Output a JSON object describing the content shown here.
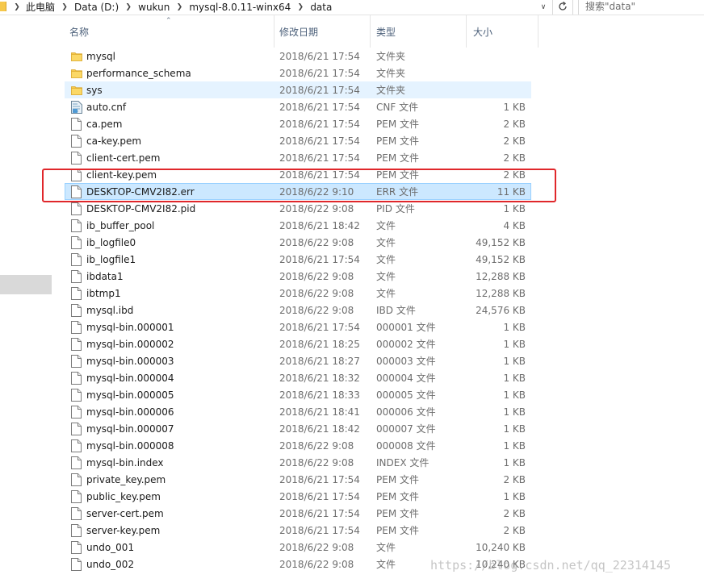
{
  "address_bar": {
    "crumbs": [
      "此电脑",
      "Data (D:)",
      "wukun",
      "mysql-8.0.11-winx64",
      "data"
    ],
    "search_placeholder": "搜索\"data\""
  },
  "columns": {
    "name": "名称",
    "date": "修改日期",
    "type": "类型",
    "size": "大小"
  },
  "files": [
    {
      "name": "mysql",
      "date": "2018/6/21 17:54",
      "type": "文件夹",
      "size": "",
      "icon": "folder-icon"
    },
    {
      "name": "performance_schema",
      "date": "2018/6/21 17:54",
      "type": "文件夹",
      "size": "",
      "icon": "folder-icon"
    },
    {
      "name": "sys",
      "date": "2018/6/21 17:54",
      "type": "文件夹",
      "size": "",
      "icon": "folder-icon"
    },
    {
      "name": "auto.cnf",
      "date": "2018/6/21 17:54",
      "type": "CNF 文件",
      "size": "1 KB",
      "icon": "config-file-icon"
    },
    {
      "name": "ca.pem",
      "date": "2018/6/21 17:54",
      "type": "PEM 文件",
      "size": "2 KB",
      "icon": "file-icon"
    },
    {
      "name": "ca-key.pem",
      "date": "2018/6/21 17:54",
      "type": "PEM 文件",
      "size": "2 KB",
      "icon": "file-icon"
    },
    {
      "name": "client-cert.pem",
      "date": "2018/6/21 17:54",
      "type": "PEM 文件",
      "size": "2 KB",
      "icon": "file-icon"
    },
    {
      "name": "client-key.pem",
      "date": "2018/6/21 17:54",
      "type": "PEM 文件",
      "size": "2 KB",
      "icon": "file-icon"
    },
    {
      "name": "DESKTOP-CMV2I82.err",
      "date": "2018/6/22 9:10",
      "type": "ERR 文件",
      "size": "11 KB",
      "icon": "file-icon"
    },
    {
      "name": "DESKTOP-CMV2I82.pid",
      "date": "2018/6/22 9:08",
      "type": "PID 文件",
      "size": "1 KB",
      "icon": "file-icon"
    },
    {
      "name": "ib_buffer_pool",
      "date": "2018/6/21 18:42",
      "type": "文件",
      "size": "4 KB",
      "icon": "file-icon"
    },
    {
      "name": "ib_logfile0",
      "date": "2018/6/22 9:08",
      "type": "文件",
      "size": "49,152 KB",
      "icon": "file-icon"
    },
    {
      "name": "ib_logfile1",
      "date": "2018/6/21 17:54",
      "type": "文件",
      "size": "49,152 KB",
      "icon": "file-icon"
    },
    {
      "name": "ibdata1",
      "date": "2018/6/22 9:08",
      "type": "文件",
      "size": "12,288 KB",
      "icon": "file-icon"
    },
    {
      "name": "ibtmp1",
      "date": "2018/6/22 9:08",
      "type": "文件",
      "size": "12,288 KB",
      "icon": "file-icon"
    },
    {
      "name": "mysql.ibd",
      "date": "2018/6/22 9:08",
      "type": "IBD 文件",
      "size": "24,576 KB",
      "icon": "file-icon"
    },
    {
      "name": "mysql-bin.000001",
      "date": "2018/6/21 17:54",
      "type": "000001 文件",
      "size": "1 KB",
      "icon": "file-icon"
    },
    {
      "name": "mysql-bin.000002",
      "date": "2018/6/21 18:25",
      "type": "000002 文件",
      "size": "1 KB",
      "icon": "file-icon"
    },
    {
      "name": "mysql-bin.000003",
      "date": "2018/6/21 18:27",
      "type": "000003 文件",
      "size": "1 KB",
      "icon": "file-icon"
    },
    {
      "name": "mysql-bin.000004",
      "date": "2018/6/21 18:32",
      "type": "000004 文件",
      "size": "1 KB",
      "icon": "file-icon"
    },
    {
      "name": "mysql-bin.000005",
      "date": "2018/6/21 18:33",
      "type": "000005 文件",
      "size": "1 KB",
      "icon": "file-icon"
    },
    {
      "name": "mysql-bin.000006",
      "date": "2018/6/21 18:41",
      "type": "000006 文件",
      "size": "1 KB",
      "icon": "file-icon"
    },
    {
      "name": "mysql-bin.000007",
      "date": "2018/6/21 18:42",
      "type": "000007 文件",
      "size": "1 KB",
      "icon": "file-icon"
    },
    {
      "name": "mysql-bin.000008",
      "date": "2018/6/22 9:08",
      "type": "000008 文件",
      "size": "1 KB",
      "icon": "file-icon"
    },
    {
      "name": "mysql-bin.index",
      "date": "2018/6/22 9:08",
      "type": "INDEX 文件",
      "size": "1 KB",
      "icon": "file-icon"
    },
    {
      "name": "private_key.pem",
      "date": "2018/6/21 17:54",
      "type": "PEM 文件",
      "size": "2 KB",
      "icon": "file-icon"
    },
    {
      "name": "public_key.pem",
      "date": "2018/6/21 17:54",
      "type": "PEM 文件",
      "size": "1 KB",
      "icon": "file-icon"
    },
    {
      "name": "server-cert.pem",
      "date": "2018/6/21 17:54",
      "type": "PEM 文件",
      "size": "2 KB",
      "icon": "file-icon"
    },
    {
      "name": "server-key.pem",
      "date": "2018/6/21 17:54",
      "type": "PEM 文件",
      "size": "2 KB",
      "icon": "file-icon"
    },
    {
      "name": "undo_001",
      "date": "2018/6/22 9:08",
      "type": "文件",
      "size": "10,240 KB",
      "icon": "file-icon"
    },
    {
      "name": "undo_002",
      "date": "2018/6/22 9:08",
      "type": "文件",
      "size": "10,240 KB",
      "icon": "file-icon"
    }
  ],
  "hover_index": 2,
  "selected_index": 8,
  "annotation_index": 8,
  "colors": {
    "selected_bg": "#cce8ff",
    "selected_border": "#99d1ff",
    "hover_bg": "#e5f3ff",
    "annotation": "#e0272b",
    "header_text": "#4c607a",
    "folder": "#f6c84b"
  },
  "watermark": "https://blog.csdn.net/qq_22314145"
}
